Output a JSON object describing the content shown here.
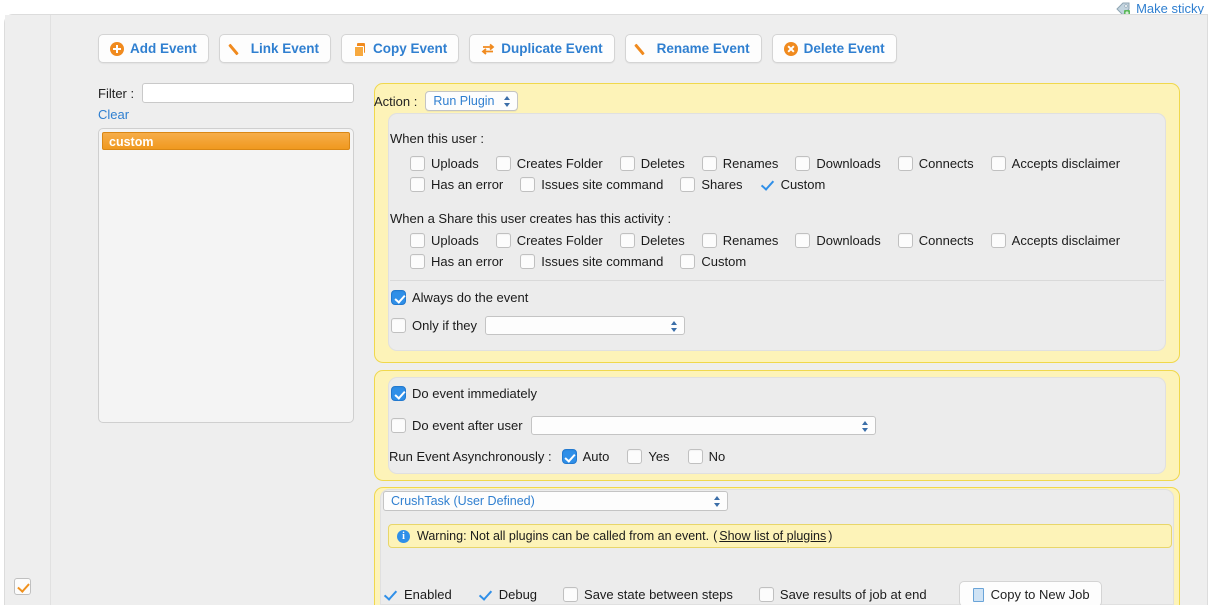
{
  "header": {
    "make_sticky_label": "Make sticky",
    "make_sticky_icon": "tag-icon"
  },
  "toolbar": {
    "buttons": [
      {
        "label": "Add Event",
        "icon": "circle-plus-icon"
      },
      {
        "label": "Link Event",
        "icon": "pencil-icon"
      },
      {
        "label": "Copy Event",
        "icon": "copy-pages-icon"
      },
      {
        "label": "Duplicate Event",
        "icon": "duplicate-arrows-icon"
      },
      {
        "label": "Rename Event",
        "icon": "pencil-icon"
      },
      {
        "label": "Delete Event",
        "icon": "circle-x-icon"
      }
    ]
  },
  "sidebar": {
    "filter_label": "Filter :",
    "filter_value": "",
    "filter_placeholder": "",
    "clear_label": "Clear",
    "items": [
      {
        "label": "custom",
        "selected": true
      }
    ]
  },
  "action": {
    "label": "Action :",
    "selected": "Run Plugin"
  },
  "trigger_user": {
    "title": "When this user :",
    "row1": [
      {
        "label": "Uploads",
        "checked": false
      },
      {
        "label": "Creates Folder",
        "checked": false
      },
      {
        "label": "Deletes",
        "checked": false
      },
      {
        "label": "Renames",
        "checked": false
      },
      {
        "label": "Downloads",
        "checked": false
      },
      {
        "label": "Connects",
        "checked": false
      },
      {
        "label": "Accepts disclaimer",
        "checked": false
      }
    ],
    "row2": [
      {
        "label": "Has an error",
        "checked": false
      },
      {
        "label": "Issues site command",
        "checked": false
      },
      {
        "label": "Shares",
        "checked": false
      },
      {
        "label": "Custom",
        "checked": true
      }
    ]
  },
  "trigger_share": {
    "title": "When a Share this user creates has this activity :",
    "row1": [
      {
        "label": "Uploads",
        "checked": false
      },
      {
        "label": "Creates Folder",
        "checked": false
      },
      {
        "label": "Deletes",
        "checked": false
      },
      {
        "label": "Renames",
        "checked": false
      },
      {
        "label": "Downloads",
        "checked": false
      },
      {
        "label": "Connects",
        "checked": false
      },
      {
        "label": "Accepts disclaimer",
        "checked": false
      }
    ],
    "row2": [
      {
        "label": "Has an error",
        "checked": false
      },
      {
        "label": "Issues site command",
        "checked": false
      },
      {
        "label": "Custom",
        "checked": false
      }
    ]
  },
  "condition": {
    "always_label": "Always do the event",
    "always_checked": true,
    "only_if_label": "Only if they",
    "only_if_checked": false,
    "only_if_value": ""
  },
  "timing": {
    "immediate_label": "Do event immediately",
    "immediate_checked": true,
    "after_user_label": "Do event after user",
    "after_user_checked": false,
    "after_user_value": "",
    "async_label": "Run Event Asynchronously :",
    "async_options": [
      {
        "label": "Auto",
        "checked": true
      },
      {
        "label": "Yes",
        "checked": false
      },
      {
        "label": "No",
        "checked": false
      }
    ]
  },
  "plugin": {
    "selected": "CrushTask (User Defined)",
    "warning_icon": "info-icon",
    "warning_text": "Warning: Not all plugins can be called from an event.",
    "warning_link_open": "(",
    "warning_link": "Show list of plugins",
    "warning_link_close": ")",
    "options": [
      {
        "label": "Enabled",
        "checked": true
      },
      {
        "label": "Debug",
        "checked": true
      },
      {
        "label": "Save state between steps",
        "checked": false
      },
      {
        "label": "Save results of job at end",
        "checked": false
      }
    ],
    "copy_job_label": "Copy to New Job",
    "copy_job_icon": "document-icon"
  },
  "corner": {
    "checkbox_checked": true
  },
  "colors": {
    "accent_orange": "#f08a1e",
    "link_blue": "#2f7fd0",
    "panel_yellow": "#fdf3b8",
    "panel_yellow_border": "#f0d84c",
    "check_blue": "#2f8fe8",
    "selected_row": "#f0991f"
  }
}
